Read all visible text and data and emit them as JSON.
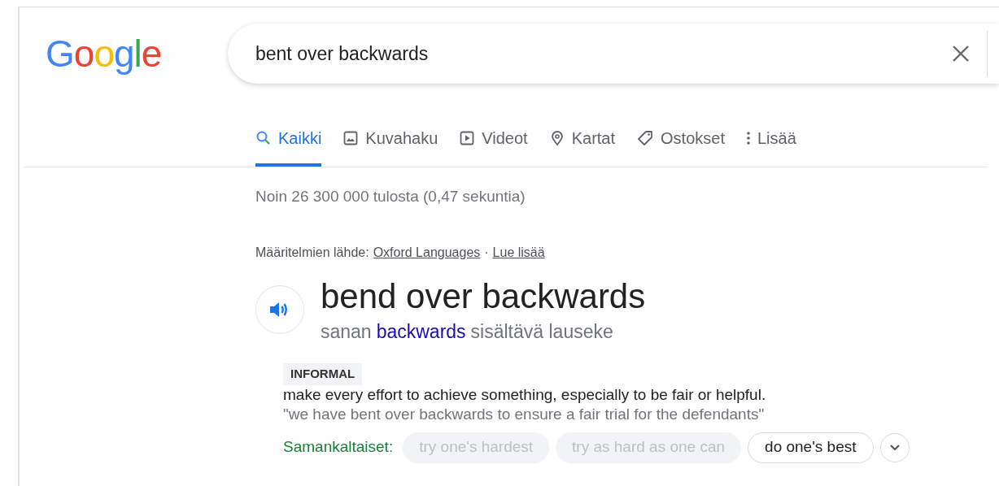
{
  "logo": {
    "text": "Google"
  },
  "search": {
    "value": "bent over backwards"
  },
  "tabs": [
    {
      "label": "Kaikki",
      "kind": "search",
      "selected": true
    },
    {
      "label": "Kuvahaku",
      "kind": "image",
      "selected": false
    },
    {
      "label": "Videot",
      "kind": "video",
      "selected": false
    },
    {
      "label": "Kartat",
      "kind": "map",
      "selected": false
    },
    {
      "label": "Ostokset",
      "kind": "tag",
      "selected": false
    },
    {
      "label": "Lisää",
      "kind": "more",
      "selected": false
    }
  ],
  "result_stats": "Noin 26 300 000 tulosta (0,47 sekuntia)",
  "source": {
    "prefix": "Määritelmien lähde:",
    "link": "Oxford Languages",
    "separator": "·",
    "more_link": "Lue lisää"
  },
  "entry": {
    "headword": "bend over backwards",
    "subtitle_before": "sanan",
    "subtitle_link": "backwards",
    "subtitle_after": "sisältävä lauseke",
    "register": "INFORMAL",
    "definition": "make every effort to achieve something, especially to be fair or helpful.",
    "example": "\"we have bent over backwards to ensure a fair trial for the defendants\"",
    "similar_label": "Samankaltaiset:",
    "similar": [
      {
        "text": "try one's hardest",
        "disabled": true
      },
      {
        "text": "try as hard as one can",
        "disabled": true
      },
      {
        "text": "do one's best",
        "disabled": false
      }
    ]
  }
}
